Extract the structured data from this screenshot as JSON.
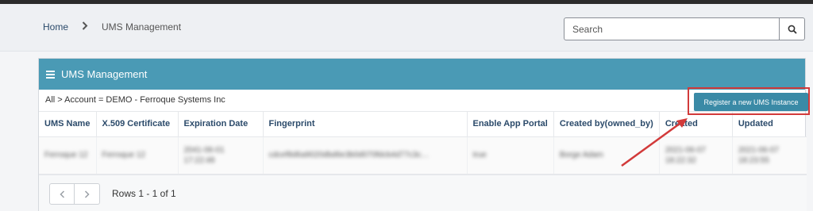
{
  "breadcrumb": {
    "home": "Home",
    "current": "UMS Management"
  },
  "search": {
    "placeholder": "Search"
  },
  "panel": {
    "title": "UMS Management",
    "filter": "All > Account = DEMO - Ferroque Systems Inc",
    "register_label": "Register a new UMS Instance"
  },
  "table": {
    "headers": [
      "UMS Name",
      "X.509 Certificate",
      "Expiration Date",
      "Fingerprint",
      "Enable App Portal",
      "Created by(owned_by)",
      "Created",
      "Updated"
    ],
    "row": [
      "Ferroque 12",
      "Ferroque 12",
      "2041-06-01 17:22:48",
      "cdcef8d6a9020dbd6e3b0d070fdcb4d77c3c…",
      "true",
      "Borge Adam",
      "2021-06-07 18:22:32",
      "2021-06-07 18:23:55"
    ]
  },
  "footer": {
    "rows_text": "Rows 1 - 1 of 1"
  },
  "colors": {
    "header_bg": "#4a9ab5",
    "button_bg": "#3a8aa6",
    "highlight": "#d23a3a"
  }
}
